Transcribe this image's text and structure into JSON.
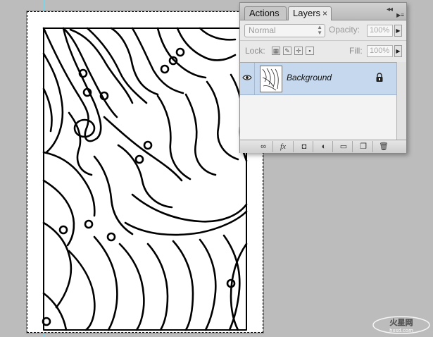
{
  "panel": {
    "tabs": [
      {
        "label": "Actions",
        "active": false
      },
      {
        "label": "Layers",
        "active": true
      }
    ],
    "close_glyph": "×",
    "blend_mode": "Normal",
    "opacity": {
      "label": "Opacity:",
      "value": "100%"
    },
    "lock": {
      "label": "Lock:",
      "icons": [
        "lock-transparent-pixels-icon",
        "lock-image-pixels-icon",
        "lock-position-icon",
        "lock-all-icon"
      ]
    },
    "fill": {
      "label": "Fill:",
      "value": "100%"
    },
    "layers": [
      {
        "name": "Background",
        "visible": true,
        "locked": true,
        "selected": true
      }
    ],
    "bottom_icons": [
      "link-layers-icon",
      "layer-style-fx-icon",
      "layer-mask-icon",
      "adjustment-layer-icon",
      "group-folder-icon",
      "new-layer-icon",
      "trash-icon"
    ],
    "bottom_glyphs": {
      "fx": "fx"
    }
  },
  "colors": {
    "workspace": "#bcbcbc",
    "guide": "#7fd3e6",
    "selected_layer": "#c6d8ee"
  }
}
